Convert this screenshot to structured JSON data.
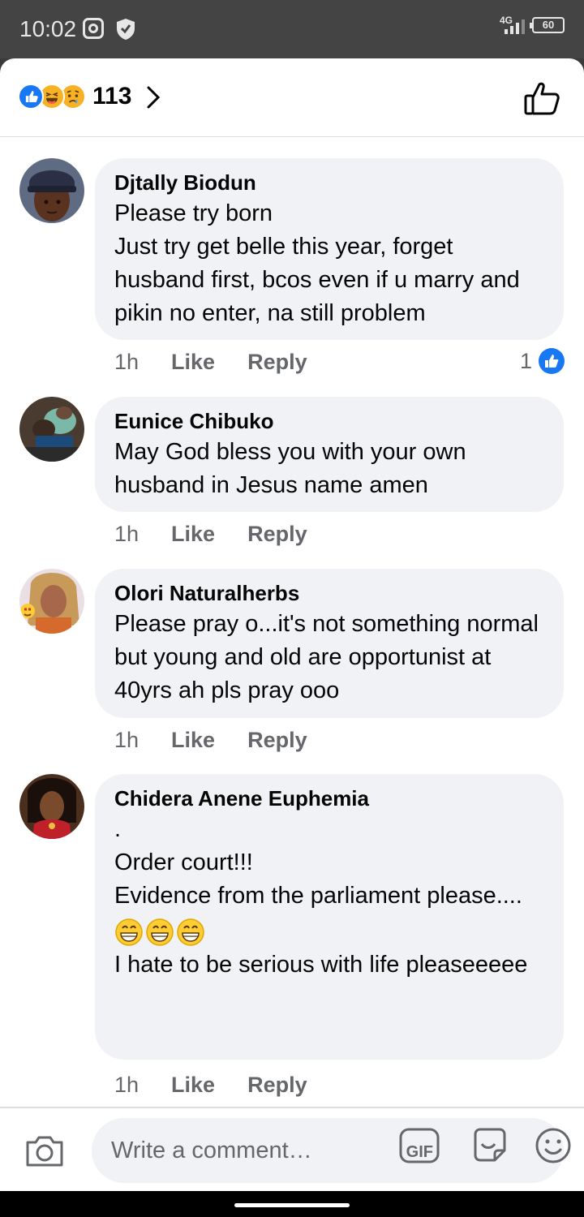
{
  "status_bar": {
    "time": "10:02",
    "network": "4G",
    "battery": "60"
  },
  "reactions_header": {
    "icons": [
      "like-icon",
      "haha-icon",
      "sad-icon"
    ],
    "count": "113"
  },
  "comments": [
    {
      "author": "Djtally Biodun",
      "text": "Please try born\nJust try get belle this year, forget husband first, bcos even if u marry and pikin no enter, na still problem",
      "time": "1h",
      "like_label": "Like",
      "reply_label": "Reply",
      "likes": "1"
    },
    {
      "author": "Eunice Chibuko",
      "text": "May God bless you with your own husband in Jesus name amen",
      "time": "1h",
      "like_label": "Like",
      "reply_label": "Reply"
    },
    {
      "author": "Olori Naturalherbs",
      "text": "Please pray o...it's not something normal but young and old are opportunist at 40yrs ah pls pray ooo",
      "time": "1h",
      "like_label": "Like",
      "reply_label": "Reply"
    },
    {
      "author": "Chidera Anene Euphemia",
      "text_before": ".\nOrder court!!!\nEvidence from the parliament please....",
      "emojis": [
        "grinning-face",
        "grinning-face",
        "grinning-face"
      ],
      "text_after": "I hate to be serious with life pleaseeeee",
      "time": "1h",
      "like_label": "Like",
      "reply_label": "Reply"
    }
  ],
  "composer": {
    "placeholder": "Write a comment…",
    "gif_label": "GIF"
  },
  "colors": {
    "accent": "#1877f2",
    "bubble": "#f0f2f5",
    "secondary_text": "#65676b"
  }
}
